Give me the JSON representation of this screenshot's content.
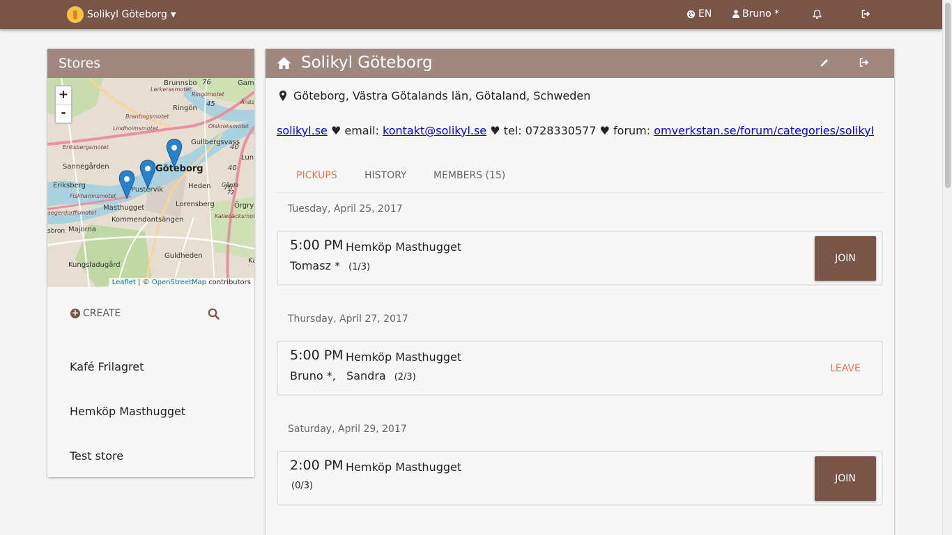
{
  "topbar": {
    "group_name": "Solikyl Göteborg",
    "language": "EN",
    "user": "Bruno *"
  },
  "stores_panel": {
    "title": "Stores",
    "zoom_in": "+",
    "zoom_out": "-",
    "attribution": {
      "leaflet": "Leaflet",
      "separator": "| ©",
      "osm": "OpenStreetMap",
      "contributors": "contributors"
    },
    "create_label": "CREATE",
    "stores": [
      "Kafé Frilagret",
      "Hemköp Masthugget",
      "Test store"
    ],
    "map_labels": [
      "Brunnsbo",
      "Lerkerasmotet",
      "Ringömotet",
      "Ringön",
      "Brantingsmotet",
      "Lindholmsmotet",
      "Olskroksmotet",
      "Gullbergsvass",
      "Eriksbergsmotet",
      "Sannegården",
      "Göteborg",
      "Lun",
      "Eriksberg",
      "Pustervik",
      "Heden",
      "Gårda",
      "Fiskhamnsmotet",
      "Masthugget",
      "Lorensberg",
      "Örgry",
      "Kommendantsängen",
      "Kallebäcksmot",
      "Majorna",
      "Guldheden",
      "Kungsladugård",
      "Gam",
      "Ånäs",
      "Ka",
      "sbron",
      "aegerdorffsmotet",
      "72",
      "76",
      "76",
      "40",
      "45",
      "40"
    ]
  },
  "main_panel": {
    "title": "Solikyl Göteborg",
    "address": "Göteborg, Västra Götalands län, Götaland, Schweden",
    "info": {
      "site_link": "solikyl.se",
      "email_prefix": " ♥ email: ",
      "email_link": "kontakt@solikyl.se",
      "tel_text": " ♥ tel: 0728330577 ♥ forum: ",
      "forum_link": "omverkstan.se/forum/categories/solikyl"
    },
    "tabs": [
      "PICKUPS",
      "HISTORY",
      "MEMBERS (15)"
    ],
    "pickups": [
      {
        "date": "Tuesday, April 25, 2017",
        "time": "5:00 PM",
        "store": "Hemköp Masthugget",
        "people": "Tomasz *",
        "count": "(1/3)",
        "action": "JOIN"
      },
      {
        "date": "Thursday, April 27, 2017",
        "time": "5:00 PM",
        "store": "Hemköp Masthugget",
        "people": "Bruno *,   Sandra",
        "count": "(2/3)",
        "action": "LEAVE"
      },
      {
        "date": "Saturday, April 29, 2017",
        "time": "2:00 PM",
        "store": "Hemköp Masthugget",
        "people": "",
        "count": "(0/3)",
        "action": "JOIN"
      }
    ]
  },
  "colors": {
    "brand": "#795548",
    "header": "#a1887f",
    "accent": "#e8734e",
    "marker": "#2a81cb"
  },
  "icons": [
    "logo-icon",
    "caret-down-icon",
    "globe-icon",
    "user-icon",
    "bell-icon",
    "sign-out-icon",
    "home-icon",
    "pencil-icon",
    "map-marker-icon",
    "plus-circle-icon",
    "search-icon"
  ]
}
